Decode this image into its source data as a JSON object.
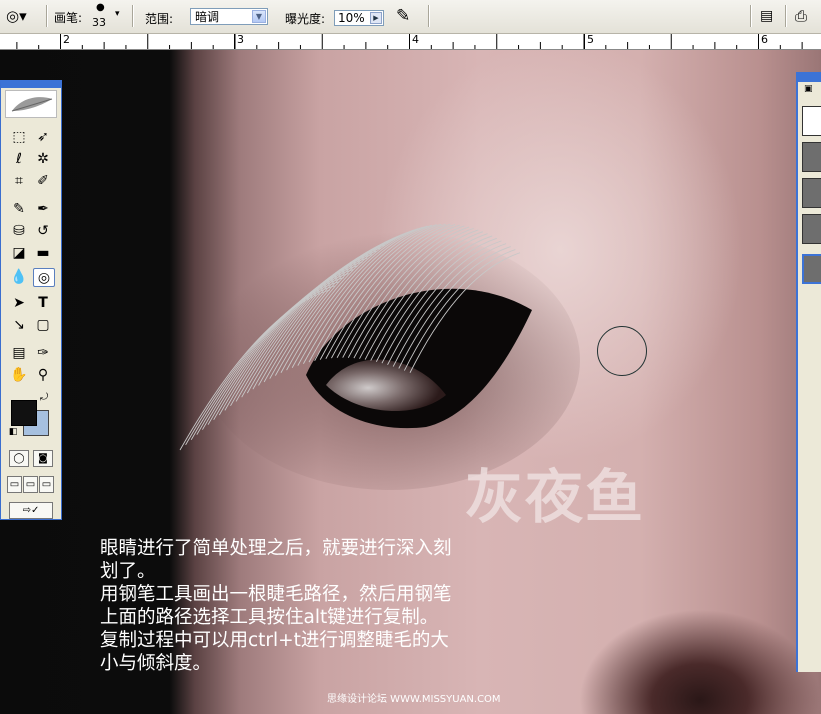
{
  "options_bar": {
    "brush_label": "画笔:",
    "brush_size": "33",
    "range_label": "范围:",
    "range_value": "暗调",
    "exposure_label": "曝光度:",
    "exposure_value": "10%"
  },
  "ruler": {
    "marks": [
      "2",
      "3",
      "4",
      "5",
      "6"
    ]
  },
  "canvas": {
    "watermark": "灰夜鱼",
    "tutorial_lines": [
      "眼睛进行了简单处理之后，就要进行深入刻",
      "划了。",
      "用钢笔工具画出一根睫毛路径，然后用钢笔",
      "上面的路径选择工具按住alt键进行复制。",
      "复制过程中可以用ctrl+t进行调整睫毛的大",
      "小与倾斜度。"
    ],
    "credit": "思缘设计论坛  WWW.MISSYUAN.COM"
  },
  "toolbox": {
    "tools": [
      "marquee-icon",
      "move-icon",
      "lasso-icon",
      "magic-wand-icon",
      "crop-icon",
      "slice-icon",
      "healing-brush-icon",
      "brush-icon",
      "clone-stamp-icon",
      "history-brush-icon",
      "eraser-icon",
      "gradient-icon",
      "blur-icon",
      "dodge-icon",
      "path-selection-icon",
      "type-icon",
      "pen-icon",
      "shape-icon",
      "notes-icon",
      "eyedropper-icon",
      "hand-icon",
      "zoom-icon"
    ],
    "active_tool": "dodge-icon",
    "foreground_color": "#111111",
    "background_color": "#a6c0df"
  }
}
